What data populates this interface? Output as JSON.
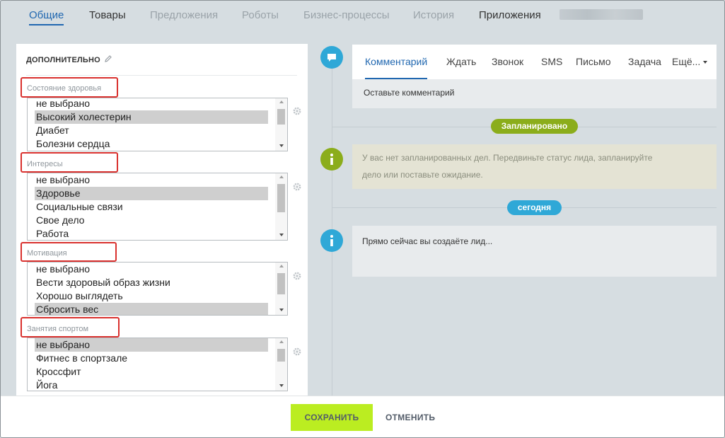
{
  "top_tabs": [
    {
      "label": "Общие"
    },
    {
      "label": "Товары"
    },
    {
      "label": "Предложения"
    },
    {
      "label": "Роботы"
    },
    {
      "label": "Бизнес-процессы"
    },
    {
      "label": "История"
    },
    {
      "label": "Приложения"
    }
  ],
  "left_panel": {
    "section_title": "ДОПОЛНИТЕЛЬНО",
    "fields": [
      {
        "label": "Состояние здоровья",
        "items": [
          "не выбрано",
          "Высокий холестерин",
          "Диабет",
          "Болезни сердца"
        ],
        "selected_index": 1
      },
      {
        "label": "Интересы",
        "items": [
          "не выбрано",
          "Здоровье",
          "Социальные связи",
          "Свое дело",
          "Работа"
        ],
        "selected_index": 1
      },
      {
        "label": "Мотивация",
        "items": [
          "не выбрано",
          "Вести здоровый образ жизни",
          "Хорошо выглядеть",
          "Сбросить вес"
        ],
        "selected_index": 3
      },
      {
        "label": "Занятия спортом",
        "items": [
          "не выбрано",
          "Фитнес в спортзале",
          "Кроссфит",
          "Йога"
        ],
        "selected_index": 0
      }
    ]
  },
  "activity": {
    "tabs": [
      "Комментарий",
      "Ждать",
      "Звонок",
      "SMS",
      "Письмо",
      "Задача",
      "Ещё..."
    ],
    "comment_placeholder": "Оставьте комментарий",
    "planned_badge": "Запланировано",
    "planned_text_line1": "У вас нет запланированных дел. Передвиньте статус лида, запланируйте",
    "planned_text_line2": "дело или поставьте ожидание.",
    "today_badge": "сегодня",
    "today_text": "Прямо сейчас вы создаёте лид..."
  },
  "footer": {
    "save_label": "СОХРАНИТЬ",
    "cancel_label": "ОТМЕНИТЬ"
  },
  "colors": {
    "accent_blue": "#2067b0",
    "save_green": "#bbed21",
    "highlight_red": "#d9312e",
    "timeline_blue": "#2fa8d7",
    "timeline_green": "#8bad1b"
  }
}
